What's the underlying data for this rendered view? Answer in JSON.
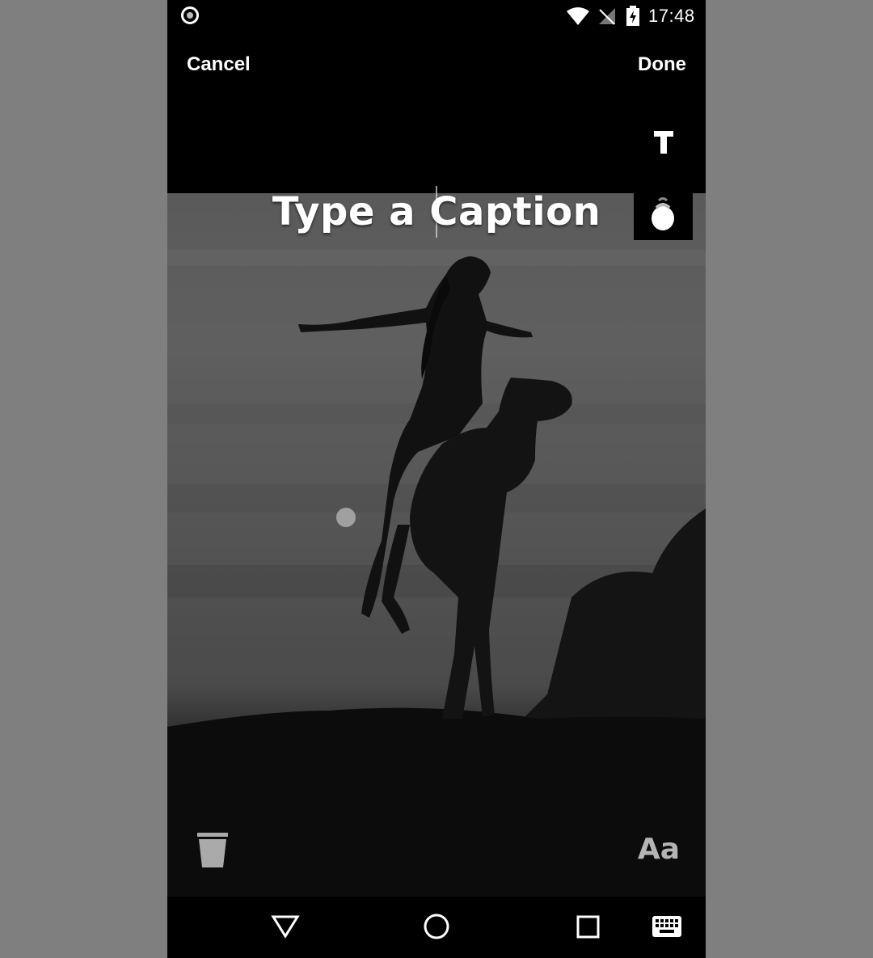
{
  "status_bar": {
    "time": "17:48",
    "icons": [
      "record-indicator-icon",
      "wifi-icon",
      "no-signal-icon",
      "battery-charging-icon"
    ]
  },
  "toolbar": {
    "cancel_label": "Cancel",
    "done_label": "Done",
    "text_tool_icon": "text-tool-icon"
  },
  "editor": {
    "caption_text": "Type a Caption",
    "color_picker_icon": "color-drop-icon",
    "delete_icon": "trash-icon",
    "font_label": "Aa"
  },
  "navigation": {
    "icons": [
      "back-icon",
      "home-icon",
      "recents-icon",
      "keyboard-icon"
    ]
  },
  "colors": {
    "background": "#7f7f7f",
    "screen": "#000000",
    "text": "#ffffff",
    "font_button": "#b5b5b5"
  }
}
